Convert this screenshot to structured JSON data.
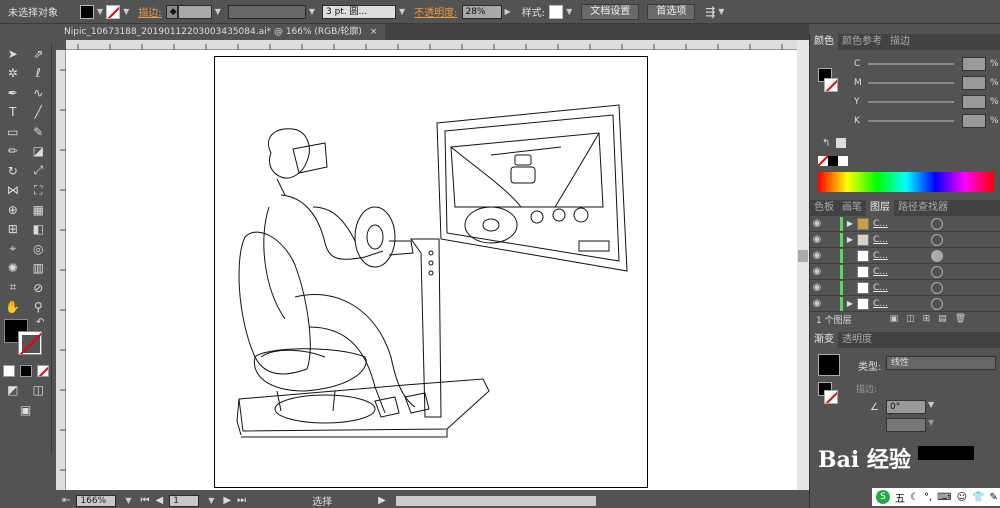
{
  "control_bar": {
    "selection_status": "未选择对象",
    "stroke_label": "描边:",
    "stroke_weight": "3 pt. 圆...",
    "opacity_label": "不透明度:",
    "opacity_value": "28%",
    "style_label": "样式:",
    "doc_setup_button": "文档设置",
    "preferences_button": "首选项"
  },
  "document_tab": {
    "title": "Nipic_10673188_20190112203003435084.ai* @ 166% (RGB/轮廓)",
    "close": "×"
  },
  "status_bar": {
    "zoom": "166%",
    "page_number": "1",
    "tool_name": "选择"
  },
  "color_panel": {
    "tabs": [
      "颜色",
      "颜色参考",
      "描边"
    ],
    "channels": [
      {
        "label": "C",
        "pct": "%"
      },
      {
        "label": "M",
        "pct": "%"
      },
      {
        "label": "Y",
        "pct": "%"
      },
      {
        "label": "K",
        "pct": "%"
      }
    ]
  },
  "layers_panel": {
    "tabs": [
      "色板",
      "画笔",
      "图层",
      "路径查找器"
    ],
    "rows": [
      {
        "expanded": true,
        "name": "C..."
      },
      {
        "expanded": true,
        "name": "C..."
      },
      {
        "expanded": false,
        "name": "C..."
      },
      {
        "expanded": false,
        "name": "C..."
      },
      {
        "expanded": false,
        "name": "C..."
      },
      {
        "expanded": true,
        "name": "C..."
      }
    ],
    "layer_count": "1 个图层"
  },
  "gradient_panel": {
    "tabs": [
      "渐变",
      "透明度"
    ],
    "type_label": "类型:",
    "type_value": "线性",
    "stroke_label": "描边:",
    "angle_value": "0°"
  },
  "watermark": "Bai 经验",
  "ime_bar": {
    "mode": "五"
  },
  "colors": {
    "ui_bg": "#535353",
    "stroke_link": "#e89a3c",
    "layer_color": "#5bd75b"
  }
}
